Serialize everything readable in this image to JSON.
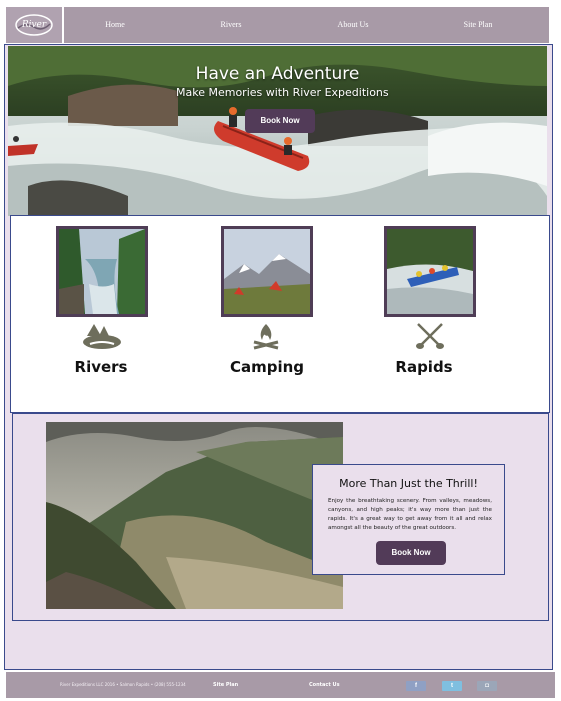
{
  "header": {
    "logo_text": "River",
    "nav": [
      "Home",
      "Rivers",
      "About Us",
      "Site Plan"
    ]
  },
  "hero": {
    "title": "Have an Adventure",
    "subtitle": "Make Memories with River Expeditions",
    "button": "Book Now"
  },
  "features": [
    {
      "label": "Rivers",
      "icon": "tree-river-icon"
    },
    {
      "label": "Camping",
      "icon": "campfire-icon"
    },
    {
      "label": "Rapids",
      "icon": "crossed-paddles-icon"
    }
  ],
  "promo": {
    "title": "More Than Just the Thrill!",
    "body": "Enjoy the breathtaking scenery. From valleys, meadows, canyons, and high peaks; it's way more than just the rapids. It's a great way to get away from it all and relax amongst all the beauty of the great outdoors.",
    "button": "Book Now"
  },
  "footer": {
    "copyright": "River Expeditions LLC 2016 • Salmon Rapids • (208) 555-1234",
    "site_plan": "Site Plan",
    "contact": "Contact Us",
    "social": [
      {
        "icon": "facebook-icon",
        "glyph": "f"
      },
      {
        "icon": "twitter-icon",
        "glyph": "t"
      },
      {
        "icon": "instagram-icon",
        "glyph": "◘"
      }
    ]
  },
  "colors": {
    "nav_bar": "#a89aa7",
    "page_bg": "#eadfec",
    "button": "#523b58",
    "border": "#3a4a8c"
  }
}
